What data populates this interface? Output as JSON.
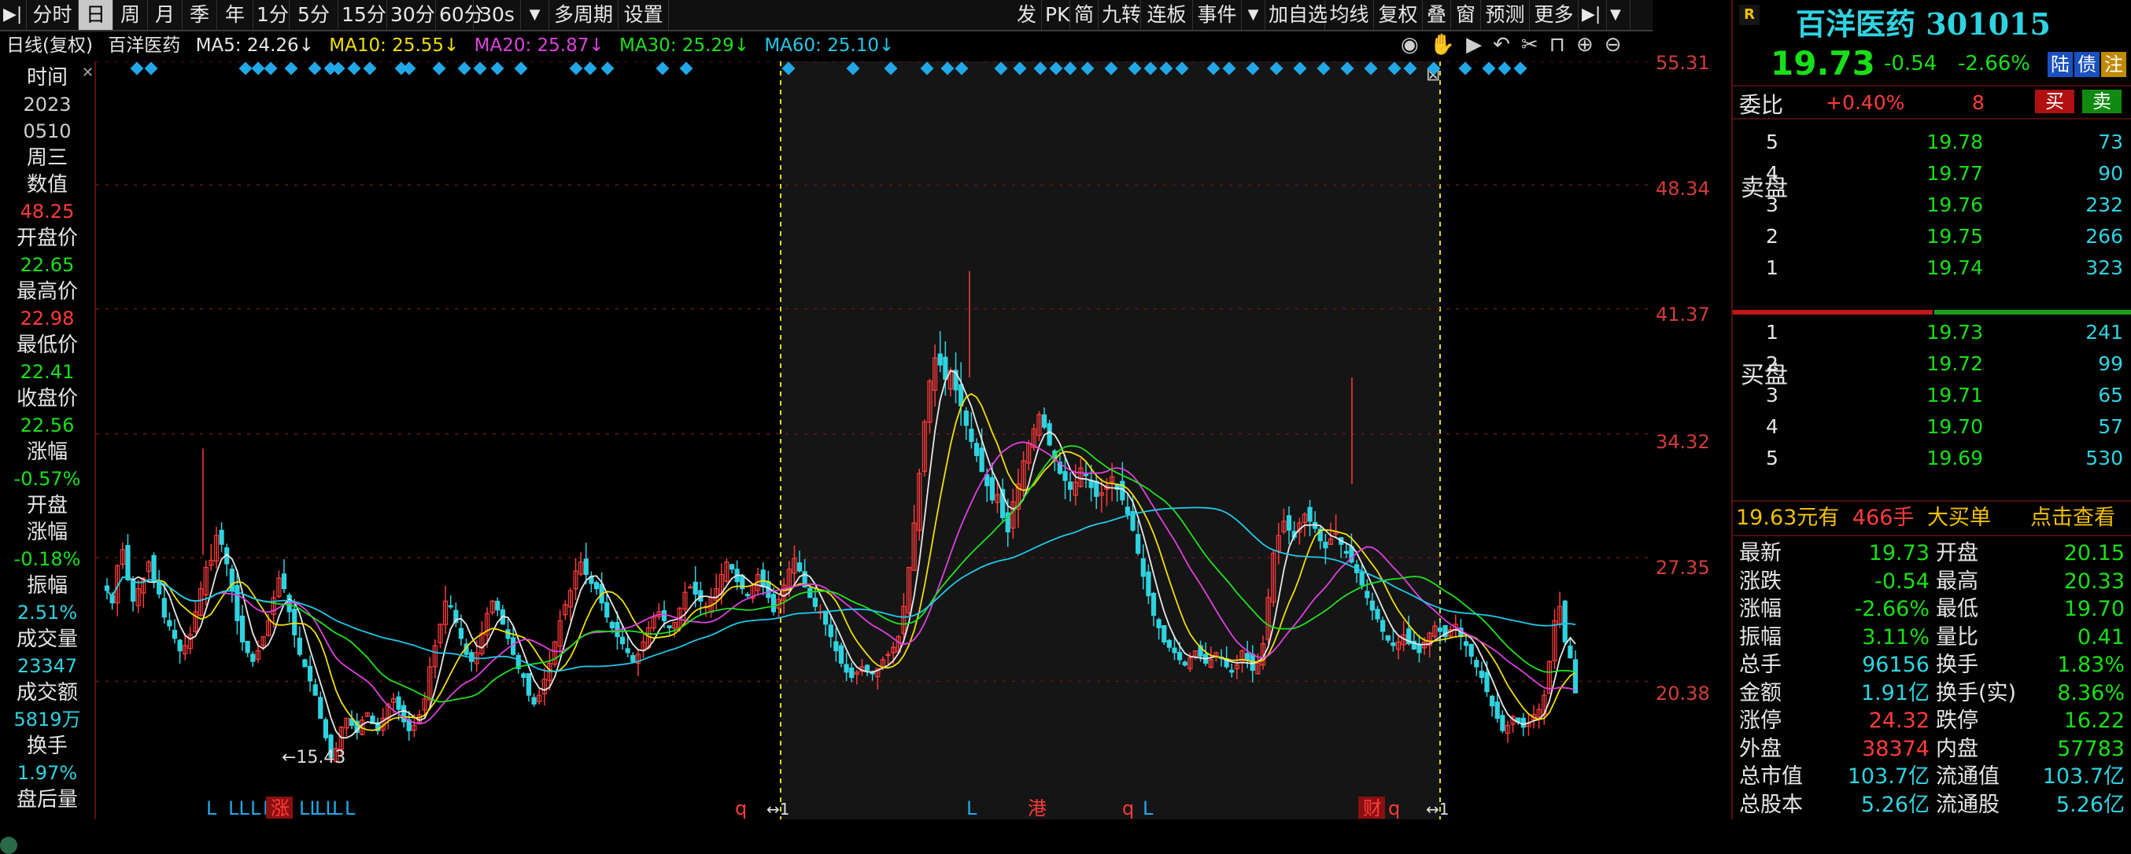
{
  "toolbar": {
    "left_items": [
      "分时",
      "日",
      "周",
      "月",
      "季",
      "年",
      "1分",
      "5分",
      "15分",
      "30分",
      "60分",
      "30s",
      "多周期",
      "设置"
    ],
    "active": "日",
    "right_items": [
      "发",
      "PK",
      "简",
      "九转",
      "连板",
      "事件",
      "加自选",
      "均线",
      "复权",
      "叠",
      "窗",
      "预测",
      "更多"
    ]
  },
  "info": {
    "period": "日线(复权)",
    "name": "百洋医药",
    "ma5": "MA5: 24.26↓",
    "ma10": "MA10: 25.55↓",
    "ma20": "MA20: 25.87↓",
    "ma30": "MA30: 25.29↓",
    "ma60": "MA60: 25.10↓",
    "colors": {
      "ma5": "#e8e8e8",
      "ma10": "#f0e000",
      "ma20": "#e040e0",
      "ma30": "#20e020",
      "ma60": "#20c8e8"
    }
  },
  "left_panel": {
    "time_label": "时间",
    "year": "2023",
    "date": "0510",
    "weekday": "周三",
    "value_label": "数值",
    "value": "48.25",
    "open_label": "开盘价",
    "open": "22.65",
    "high_label": "最高价",
    "high": "22.98",
    "low_label": "最低价",
    "low": "22.41",
    "close_label": "收盘价",
    "close": "22.56",
    "change_label": "涨幅",
    "change": "-0.57%",
    "open_change_label1": "开盘",
    "open_change_label2": "涨幅",
    "open_change": "-0.18%",
    "amplitude_label": "振幅",
    "amplitude": "2.51%",
    "volume_label": "成交量",
    "volume": "23347",
    "turnover_label": "成交额",
    "turnover": "5819万",
    "exchange_label": "换手",
    "exchange": "1.97%",
    "after_label": "盘后量"
  },
  "price_axis": [
    "55.31",
    "48.34",
    "41.37",
    "34.32",
    "27.35",
    "20.38"
  ],
  "chart_data": {
    "type": "candlestick",
    "y_range": [
      13.4,
      55.31
    ],
    "low_marker": "15.43",
    "close_series": [
      25.5,
      24.8,
      26.9,
      27.8,
      26.1,
      24.9,
      25.6,
      26.2,
      27.1,
      26.0,
      25.3,
      24.0,
      23.5,
      22.8,
      22.1,
      22.4,
      23.0,
      24.3,
      25.6,
      26.8,
      27.2,
      28.6,
      28.1,
      27.0,
      25.5,
      23.8,
      22.6,
      22.0,
      21.5,
      22.1,
      22.9,
      23.8,
      25.1,
      26.2,
      25.6,
      24.3,
      23.0,
      21.9,
      21.2,
      20.4,
      19.6,
      18.3,
      17.2,
      16.1,
      16.6,
      17.8,
      18.3,
      17.9,
      17.5,
      18.2,
      18.6,
      18.0,
      17.6,
      18.3,
      19.1,
      19.4,
      18.8,
      18.1,
      17.6,
      17.9,
      18.5,
      19.4,
      21.2,
      22.4,
      23.6,
      24.9,
      24.6,
      23.7,
      22.8,
      21.9,
      21.5,
      22.0,
      23.1,
      24.2,
      24.9,
      24.4,
      23.6,
      22.8,
      21.9,
      21.1,
      20.6,
      19.6,
      19.1,
      19.6,
      20.5,
      21.4,
      22.6,
      23.8,
      24.7,
      25.5,
      26.6,
      27.1,
      26.4,
      25.9,
      25.6,
      24.8,
      24.0,
      23.4,
      22.9,
      22.5,
      22.0,
      21.5,
      21.9,
      22.6,
      23.4,
      24.0,
      24.3,
      23.8,
      23.4,
      23.7,
      24.5,
      25.4,
      25.7,
      25.3,
      24.9,
      24.6,
      25.1,
      25.6,
      26.4,
      27.1,
      26.7,
      26.0,
      25.6,
      25.2,
      25.8,
      26.4,
      25.7,
      25.1,
      24.3,
      25.0,
      25.8,
      26.7,
      27.3,
      26.6,
      25.7,
      25.1,
      24.6,
      24.3,
      23.6,
      22.9,
      22.1,
      21.4,
      20.9,
      20.6,
      20.9,
      21.2,
      21.0,
      20.8,
      21.1,
      21.6,
      21.9,
      22.3,
      22.9,
      24.6,
      26.8,
      29.3,
      32.1,
      35.0,
      37.3,
      38.6,
      38.2,
      37.4,
      37.9,
      36.8,
      35.9,
      34.8,
      33.9,
      33.1,
      32.2,
      31.4,
      30.6,
      30.9,
      29.6,
      28.8,
      30.5,
      31.5,
      32.8,
      33.8,
      34.6,
      35.4,
      34.7,
      33.7,
      32.9,
      32.1,
      31.7,
      31.2,
      31.6,
      32.4,
      32.0,
      31.3,
      30.8,
      31.0,
      31.4,
      31.9,
      31.2,
      30.6,
      29.8,
      28.9,
      27.6,
      26.3,
      25.2,
      24.1,
      23.4,
      22.6,
      22.3,
      22.0,
      21.6,
      21.3,
      21.7,
      22.1,
      21.8,
      21.4,
      21.6,
      22.0,
      21.7,
      21.2,
      20.9,
      21.3,
      22.1,
      21.6,
      21.0,
      21.4,
      22.5,
      25.1,
      27.6,
      28.6,
      29.4,
      28.9,
      28.5,
      29.3,
      29.8,
      29.4,
      29.0,
      28.3,
      27.9,
      28.4,
      28.8,
      28.1,
      27.6,
      27.1,
      26.5,
      25.8,
      25.1,
      24.4,
      23.9,
      23.2,
      22.7,
      22.4,
      22.6,
      23.0,
      22.5,
      22.2,
      22.0,
      22.6,
      23.1,
      23.5,
      23.2,
      22.9,
      23.3,
      23.6,
      22.9,
      22.4,
      21.8,
      21.2,
      20.6,
      19.8,
      19.0,
      18.3,
      17.6,
      17.9,
      18.4,
      18.1,
      17.8,
      18.0,
      18.5,
      18.8,
      19.6,
      21.5,
      23.8,
      24.6,
      22.6,
      21.7,
      19.73
    ]
  },
  "markers": {
    "gap_label": "1",
    "bottom_labels": [
      "L",
      "LL",
      "L",
      "L",
      "涨",
      "LL",
      "LL",
      "L",
      "L",
      "q",
      "L",
      "港",
      "q",
      "L",
      "财",
      "q"
    ]
  },
  "right_panel": {
    "badge": "R",
    "stock_name": "百洋医药",
    "stock_code": "301015",
    "price": "19.73",
    "change": "-0.54",
    "change_pct": "-2.66%",
    "tag1": "陆",
    "tag2": "债",
    "tag3": "注",
    "weibi_label": "委比",
    "weibi": "+0.40%",
    "weicha": "8",
    "buy_btn": "买",
    "sell_btn": "卖",
    "ask_label": "卖盘",
    "bid_label": "买盘",
    "asks": [
      {
        "level": "5",
        "price": "19.78",
        "vol": "73"
      },
      {
        "level": "4",
        "price": "19.77",
        "vol": "90"
      },
      {
        "level": "3",
        "price": "19.76",
        "vol": "232"
      },
      {
        "level": "2",
        "price": "19.75",
        "vol": "266"
      },
      {
        "level": "1",
        "price": "19.74",
        "vol": "323"
      }
    ],
    "bids": [
      {
        "level": "1",
        "price": "19.73",
        "vol": "241"
      },
      {
        "level": "2",
        "price": "19.72",
        "vol": "99"
      },
      {
        "level": "3",
        "price": "19.71",
        "vol": "65"
      },
      {
        "level": "4",
        "price": "19.70",
        "vol": "57"
      },
      {
        "level": "5",
        "price": "19.69",
        "vol": "530"
      }
    ],
    "bigorder_price": "19.63元有",
    "bigorder_vol": "466手",
    "bigorder_text": "大买单",
    "bigorder_link": "点击查看",
    "stats": [
      {
        "l1": "最新",
        "v1": "19.73",
        "c1": "green",
        "l2": "开盘",
        "v2": "20.15",
        "c2": "green"
      },
      {
        "l1": "涨跌",
        "v1": "-0.54",
        "c1": "green",
        "l2": "最高",
        "v2": "20.33",
        "c2": "green"
      },
      {
        "l1": "涨幅",
        "v1": "-2.66%",
        "c1": "green",
        "l2": "最低",
        "v2": "19.70",
        "c2": "green"
      },
      {
        "l1": "振幅",
        "v1": "3.11%",
        "c1": "green",
        "l2": "量比",
        "v2": "0.41",
        "c2": "green"
      },
      {
        "l1": "总手",
        "v1": "96156",
        "c1": "cyan",
        "l2": "换手",
        "v2": "1.83%",
        "c2": "green"
      },
      {
        "l1": "金额",
        "v1": "1.91亿",
        "c1": "cyan",
        "l2": "换手(实)",
        "v2": "8.36%",
        "c2": "green"
      },
      {
        "l1": "涨停",
        "v1": "24.32",
        "c1": "red",
        "l2": "跌停",
        "v2": "16.22",
        "c2": "green"
      },
      {
        "l1": "外盘",
        "v1": "38374",
        "c1": "red",
        "l2": "内盘",
        "v2": "57783",
        "c2": "green"
      },
      {
        "l1": "总市值",
        "v1": "103.7亿",
        "c1": "cyan",
        "l2": "流通值",
        "v2": "103.7亿",
        "c2": "cyan"
      },
      {
        "l1": "总股本",
        "v1": "5.26亿",
        "c1": "cyan",
        "l2": "流通股",
        "v2": "5.26亿",
        "c2": "cyan"
      }
    ]
  }
}
